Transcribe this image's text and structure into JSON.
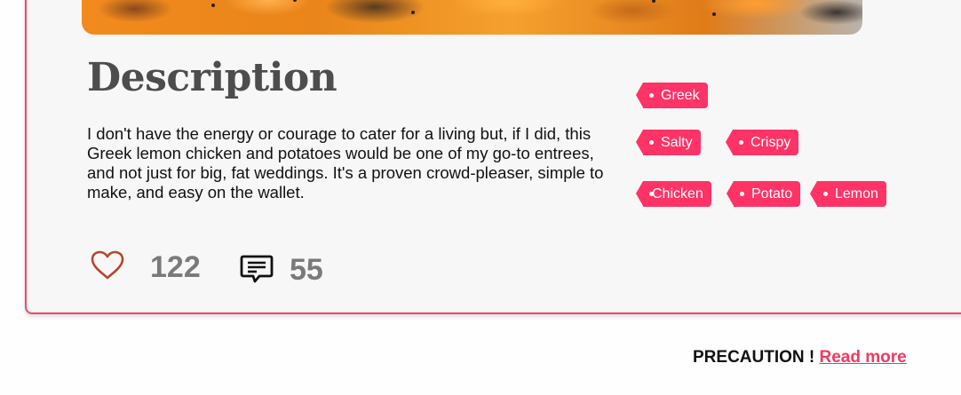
{
  "recipe": {
    "section_title": "Description",
    "description": "I don't have the energy or courage to cater for a living but, if I did, this Greek lemon chicken and potatoes would be one of my go-to entrees, and not just for big, fat weddings. It's a proven crowd-pleaser, simple to make, and easy on the wallet.",
    "tags": [
      "Greek",
      "Salty",
      "Crispy",
      "Chicken",
      "Potato",
      "Lemon"
    ],
    "likes": "122",
    "comments": "55",
    "like_icon": "heart-outline-icon",
    "comment_icon": "comment-icon"
  },
  "footer": {
    "precaution_label": "PRECAUTION !",
    "read_more_label": "Read more"
  },
  "colors": {
    "accent": "#ff3366",
    "card_border": "#f0476a",
    "heart": "#b5472c",
    "link": "#f03a5f"
  }
}
